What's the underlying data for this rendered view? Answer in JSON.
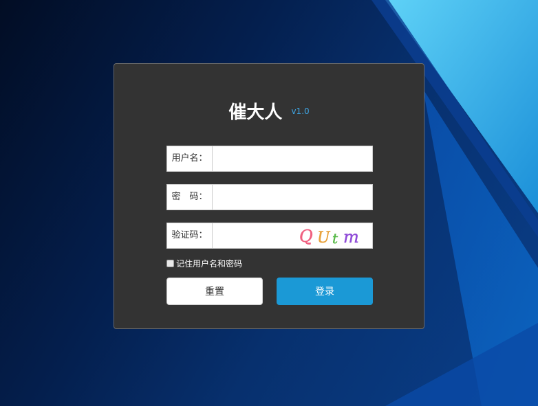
{
  "app": {
    "title": "催大人",
    "version": "v1.0"
  },
  "form": {
    "username_label": "用户名：",
    "username_value": "",
    "password_label": "密　码：",
    "password_value": "",
    "captcha_label": "验证码：",
    "captcha_value": "",
    "captcha_image_text": "QUtm",
    "remember_label": "记住用户名和密码",
    "remember_checked": false
  },
  "buttons": {
    "reset_label": "重置",
    "login_label": "登录"
  },
  "colors": {
    "panel": "#333333",
    "accent": "#1b99d6",
    "version": "#3fa8e8"
  }
}
